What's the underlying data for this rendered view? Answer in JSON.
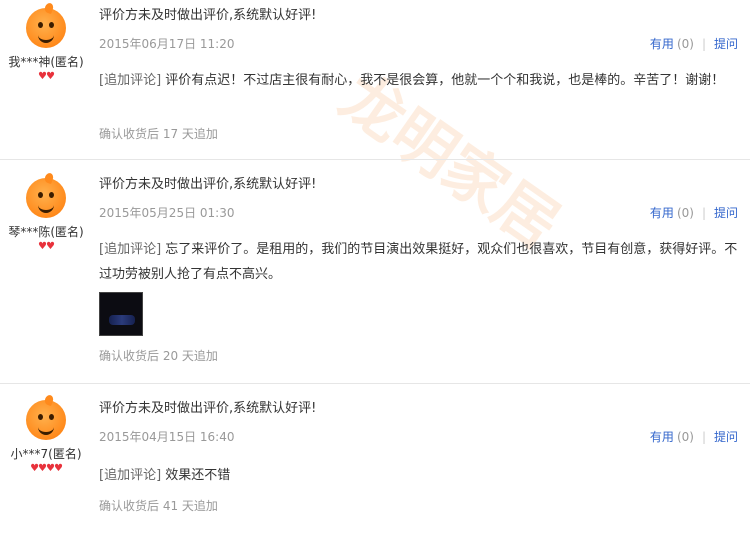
{
  "watermark": "龙明家居",
  "reviews": [
    {
      "username": "我***神(匿名)",
      "hearts": "♥♥",
      "title": "评价方未及时做出评价,系统默认好评!",
      "date": "2015年06月17日 11:20",
      "useful_label": "有用",
      "useful_count": "(0)",
      "ask_label": "提问",
      "append_tag": "[追加评论]",
      "append_text": " 评价有点迟！不过店主很有耐心，我不是很会算，他就一个个和我说，也是棒的。辛苦了！谢谢！",
      "confirm": "确认收货后 17 天追加"
    },
    {
      "username": "琴***陈(匿名)",
      "hearts": "♥♥",
      "title": "评价方未及时做出评价,系统默认好评!",
      "date": "2015年05月25日 01:30",
      "useful_label": "有用",
      "useful_count": "(0)",
      "ask_label": "提问",
      "append_tag": "[追加评论]",
      "append_text": " 忘了来评价了。是租用的，我们的节目演出效果挺好，观众们也很喜欢，节目有创意，获得好评。不过功劳被别人抢了有点不高兴。",
      "confirm": "确认收货后 20 天追加"
    },
    {
      "username": "小***7(匿名)",
      "hearts": "♥♥♥♥",
      "title": "评价方未及时做出评价,系统默认好评!",
      "date": "2015年04月15日 16:40",
      "useful_label": "有用",
      "useful_count": "(0)",
      "ask_label": "提问",
      "append_tag": "[追加评论]",
      "append_text": " 效果还不错",
      "confirm": "确认收货后 41 天追加"
    }
  ]
}
